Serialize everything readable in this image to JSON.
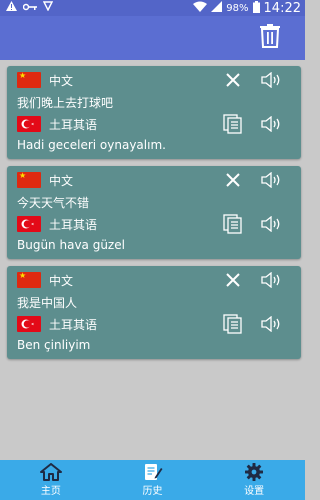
{
  "status_bar": {
    "battery": "98%",
    "time": "14:22"
  },
  "colors": {
    "app_bar": "#5b6ed2",
    "card": "#5d8e8e",
    "bottom_nav": "#3aaae8",
    "background": "#c9c9c9"
  },
  "history": [
    {
      "source_lang": "中文",
      "source_text": "我们晚上去打球吧",
      "target_lang": "土耳其语",
      "target_text": "Hadi geceleri oynayalım."
    },
    {
      "source_lang": "中文",
      "source_text": "今天天气不错",
      "target_lang": "土耳其语",
      "target_text": "Bugün hava güzel"
    },
    {
      "source_lang": "中文",
      "source_text": "我是中国人",
      "target_lang": "土耳其语",
      "target_text": "Ben çinliyim"
    }
  ],
  "bottom_nav": {
    "home_label": "主页",
    "history_label": "历史",
    "settings_label": "设置"
  }
}
